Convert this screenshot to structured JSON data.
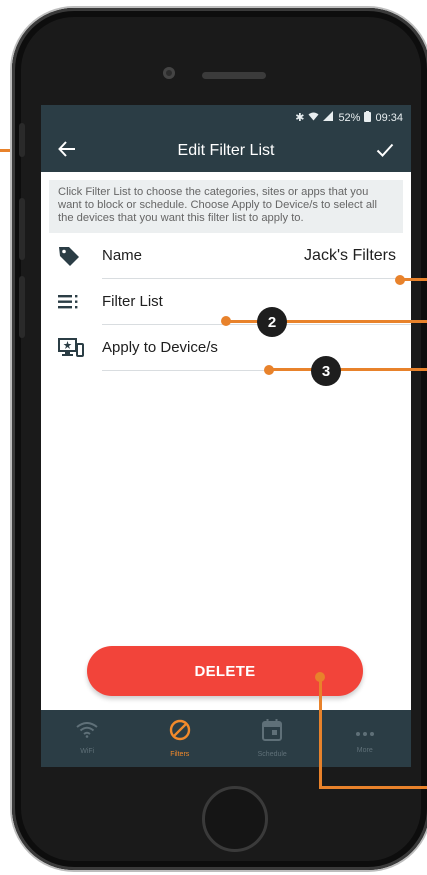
{
  "status_bar": {
    "battery": "52%",
    "time": "09:34"
  },
  "app_bar": {
    "title": "Edit Filter List"
  },
  "info_text": "Click Filter List to choose the categories, sites or apps that you want to block or schedule. Choose Apply to Device/s to select all the devices that you want this filter list to apply to.",
  "rows": [
    {
      "label": "Name",
      "value": "Jack's Filters",
      "icon": "tag-icon"
    },
    {
      "label": "Filter List",
      "icon": "list-icon"
    },
    {
      "label": "Apply to Device/s",
      "icon": "devices-icon"
    }
  ],
  "delete_label": "DELETE",
  "bottom_nav": [
    {
      "label": "WiFi",
      "icon": "wifi-icon"
    },
    {
      "label": "Filters",
      "icon": "block-icon",
      "active": true
    },
    {
      "label": "Schedule",
      "icon": "calendar-icon"
    },
    {
      "label": "More",
      "icon": "more-icon"
    }
  ],
  "callouts": {
    "filter_list_badge": "2",
    "devices_badge": "3"
  },
  "colors": {
    "app_bar": "#2b3d45",
    "accent": "#f28a2b",
    "delete": "#f2443a",
    "callout": "#e8822b"
  }
}
